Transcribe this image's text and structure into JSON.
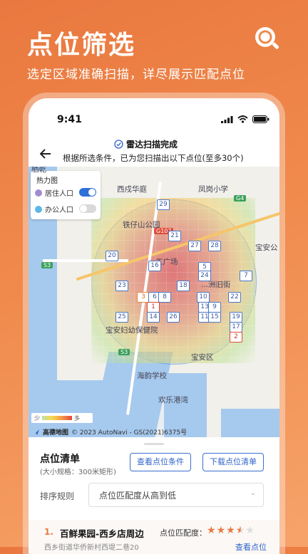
{
  "hero": {
    "title": "点位筛选",
    "subtitle": "选定区域准确扫描，详尽展示匹配点位",
    "icon": "search-icon"
  },
  "status_bar": {
    "time": "9:41"
  },
  "header": {
    "title": "雷达扫描完成",
    "description": "根据所选条件，已为您扫描出以下点位(至多30个)"
  },
  "heat_panel": {
    "title": "热力图",
    "rows": [
      {
        "label": "居住人口",
        "icon": "home-icon",
        "enabled": true
      },
      {
        "label": "办公人口",
        "icon": "office-icon",
        "enabled": false
      }
    ]
  },
  "map": {
    "places": [
      "栖乾",
      "西戍华庭",
      "凤岗小学",
      "铁仔山公园",
      "宝安公",
      "宝安妇幼保健院",
      "海韵学校",
      "宝安区",
      "欢乐港湾",
      "...工广场",
      "...洲旧街"
    ],
    "road_labels": [
      "G4",
      "G107",
      "S3",
      "S3"
    ],
    "labels": [
      "29",
      "21",
      "27",
      "28",
      "20",
      "16",
      "5",
      "24",
      "7",
      "23",
      "3",
      "6",
      "8",
      "18",
      "10",
      "22",
      "1",
      "13",
      "9",
      "25",
      "14",
      "26",
      "11",
      "15",
      "19",
      "17",
      "2"
    ],
    "legend": {
      "low": "少",
      "high": "多"
    },
    "copyright": "© 2023 AutoNavi - GS(2021)6375号",
    "logo": "高德地图"
  },
  "list": {
    "title": "点位清单",
    "subtitle": "(大小规格：300米矩形)",
    "buttons": {
      "conditions": "查看点位条件",
      "download": "下载点位清单"
    },
    "sort_label": "排序规则",
    "sort_value": "点位匹配度从高到低",
    "items": [
      {
        "rank": "1.",
        "name": "百鲜果园-西乡店周边",
        "rating_label": "点位匹配度：",
        "rating": 3.5,
        "rating_max": 5,
        "address": "西乡街道华侨新村西堤二巷20",
        "link": "查看点位"
      }
    ]
  },
  "colors": {
    "accent": "#e9783f",
    "primary": "#2e63c9",
    "toggle_on": "#2e6fd8",
    "toggle_off": "#d9d9d9"
  }
}
